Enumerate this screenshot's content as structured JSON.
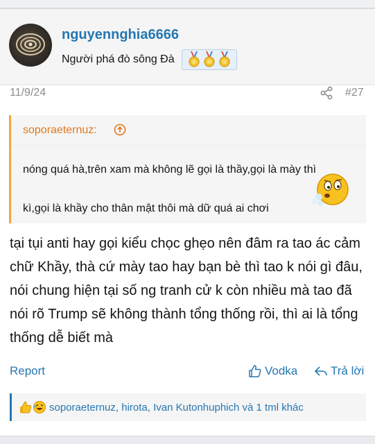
{
  "post": {
    "username": "nguyennghia6666",
    "user_title": "Người phá đò sông Đà",
    "date": "11/9/24",
    "post_number": "#27",
    "icons": {
      "share": "share-icon",
      "medals": [
        "gold-medal-icon",
        "gold-medal-icon",
        "gold-medal-icon"
      ]
    },
    "colors": {
      "link": "#2577b1",
      "quote_accent": "#f0a73c",
      "quote_author": "#e0781c"
    }
  },
  "quote": {
    "author": "soporaeternuz:",
    "line1": "nóng quá hà,trên xam mà không lẽ gọi là thầy,gọi là mày thì",
    "line2": "kì,gọi là khầy cho thân mật thôi mà dữ quá ai chơi"
  },
  "body": {
    "text": "tại tụi anti hay gọi kiểu chọc ghẹo nên đâm ra tao ác cảm chữ Khầy, thà cứ mày tao hay bạn bè thì tao k nói gì đâu, nói chung hiện tại số ng tranh cử k còn nhiều mà tao đã nói rõ Trump sẽ không thành tổng thống rồi, thì ai là tổng thống dễ biết mà"
  },
  "actions": {
    "report": "Report",
    "like": "Vodka",
    "reply": "Trả lời"
  },
  "reactions": {
    "text": "soporaeternuz, hirota, Ivan Kutonhuphich và 1 tml khác",
    "icons": [
      "thumbs-up-icon",
      "laughing-emoji-icon"
    ]
  }
}
